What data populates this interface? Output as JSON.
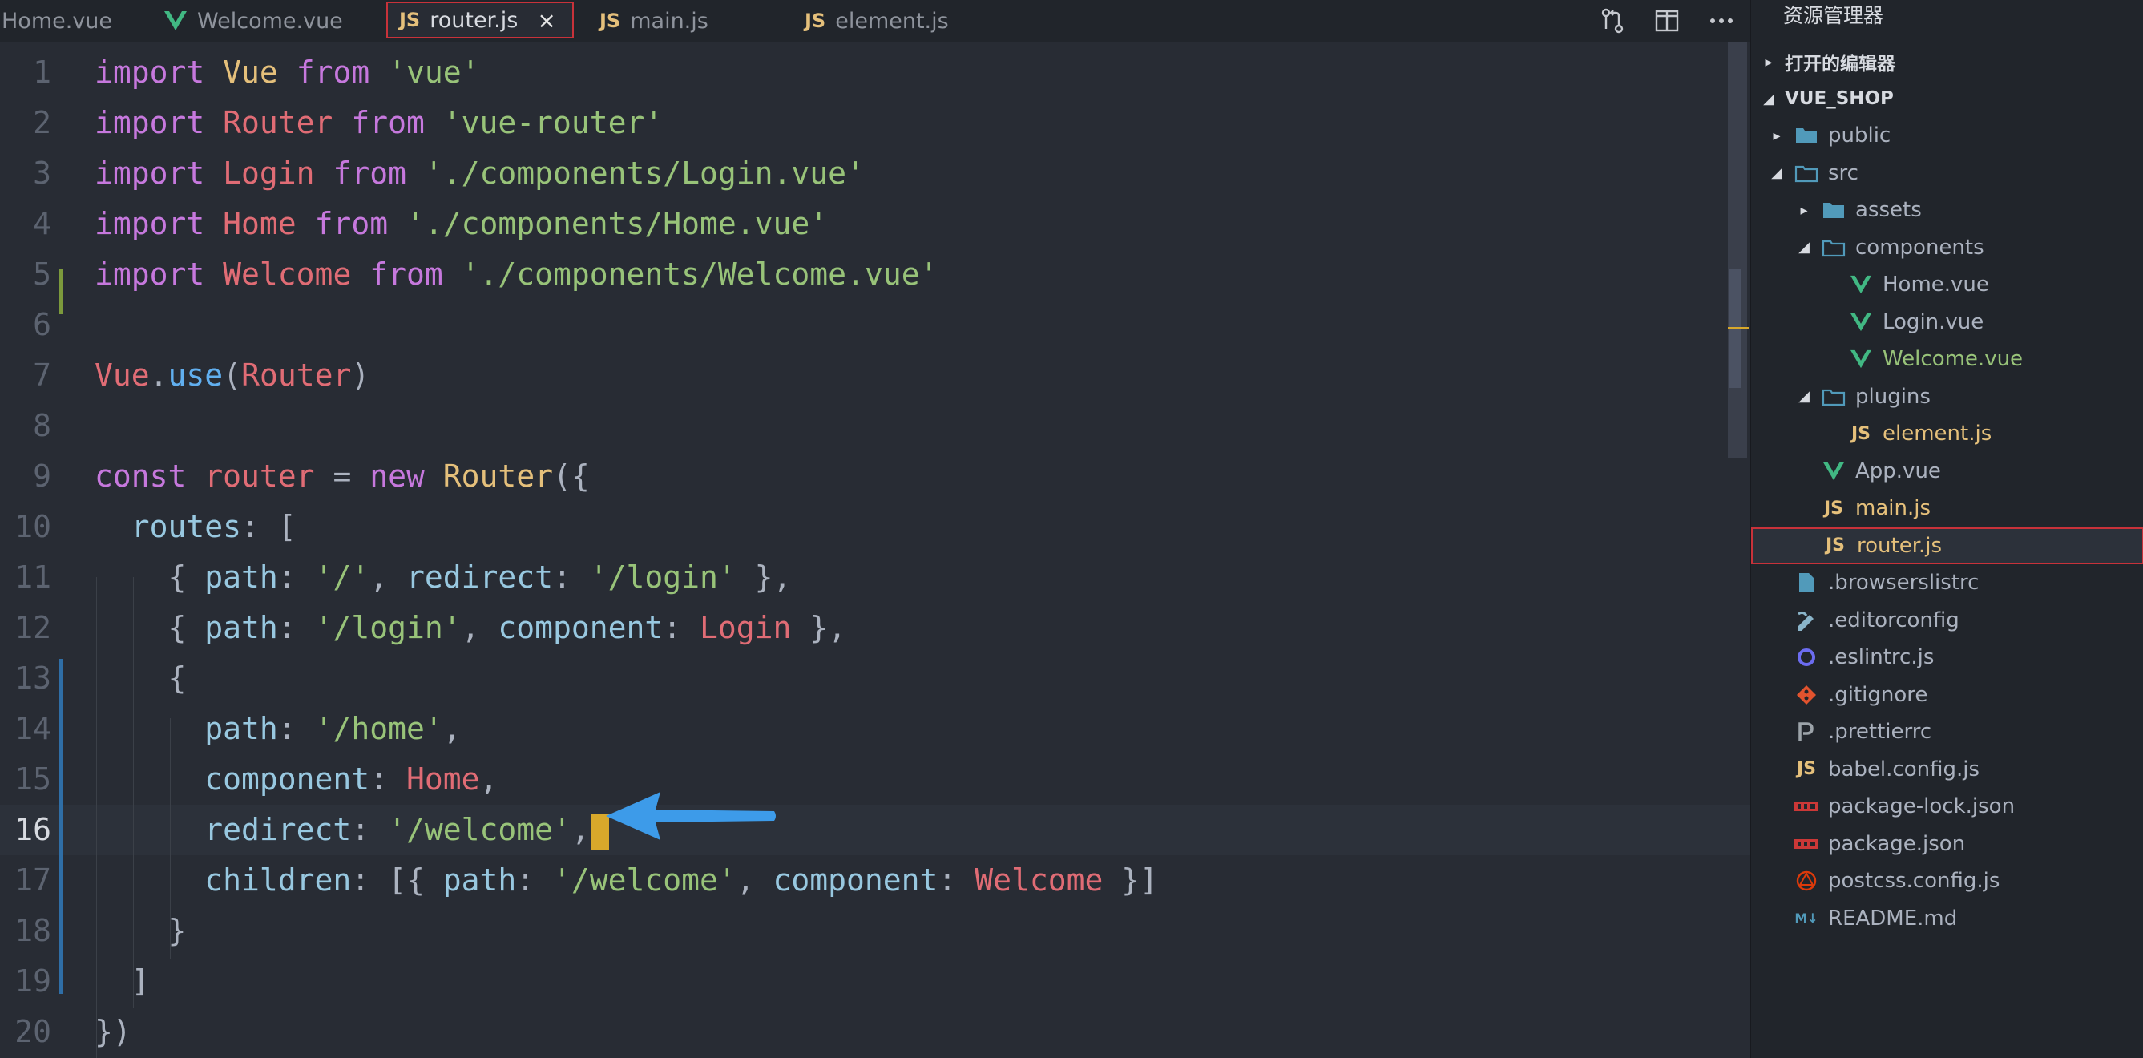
{
  "tabs": [
    {
      "label": "Home.vue",
      "type": "vue",
      "active": false
    },
    {
      "label": "Welcome.vue",
      "type": "vue",
      "active": false
    },
    {
      "label": "router.js",
      "type": "js",
      "active": true
    },
    {
      "label": "main.js",
      "type": "js",
      "active": false
    },
    {
      "label": "element.js",
      "type": "js",
      "active": false
    }
  ],
  "tab_close_glyph": "×",
  "js_badge": "JS",
  "sidebar": {
    "title": "资源管理器",
    "sections": {
      "open_editors": "打开的编辑器",
      "project": "VUE_SHOP"
    },
    "tree": [
      {
        "label": "public",
        "depth": 1,
        "kind": "folder",
        "open": false
      },
      {
        "label": "src",
        "depth": 1,
        "kind": "folder",
        "open": true
      },
      {
        "label": "assets",
        "depth": 2,
        "kind": "folder",
        "open": false
      },
      {
        "label": "components",
        "depth": 2,
        "kind": "folder",
        "open": true
      },
      {
        "label": "Home.vue",
        "depth": 3,
        "kind": "vue"
      },
      {
        "label": "Login.vue",
        "depth": 3,
        "kind": "vue"
      },
      {
        "label": "Welcome.vue",
        "depth": 3,
        "kind": "vue"
      },
      {
        "label": "plugins",
        "depth": 2,
        "kind": "folder",
        "open": true
      },
      {
        "label": "element.js",
        "depth": 3,
        "kind": "js"
      },
      {
        "label": "App.vue",
        "depth": 2,
        "kind": "vue"
      },
      {
        "label": "main.js",
        "depth": 2,
        "kind": "js"
      },
      {
        "label": "router.js",
        "depth": 2,
        "kind": "js",
        "selected": true
      },
      {
        "label": ".browserslistrc",
        "depth": 1,
        "kind": "file"
      },
      {
        "label": ".editorconfig",
        "depth": 1,
        "kind": "editorconfig"
      },
      {
        "label": ".eslintrc.js",
        "depth": 1,
        "kind": "eslint"
      },
      {
        "label": ".gitignore",
        "depth": 1,
        "kind": "git"
      },
      {
        "label": ".prettierrc",
        "depth": 1,
        "kind": "prettier"
      },
      {
        "label": "babel.config.js",
        "depth": 1,
        "kind": "js"
      },
      {
        "label": "package-lock.json",
        "depth": 1,
        "kind": "npm"
      },
      {
        "label": "package.json",
        "depth": 1,
        "kind": "npm"
      },
      {
        "label": "postcss.config.js",
        "depth": 1,
        "kind": "postcss"
      },
      {
        "label": "README.md",
        "depth": 1,
        "kind": "md"
      }
    ]
  },
  "editor": {
    "current_line": 16,
    "lines": [
      [
        [
          "kw",
          "import"
        ],
        [
          "pun",
          " "
        ],
        [
          "cls",
          "Vue"
        ],
        [
          "pun",
          " "
        ],
        [
          "kw",
          "from"
        ],
        [
          "pun",
          " "
        ],
        [
          "str",
          "'vue'"
        ]
      ],
      [
        [
          "kw",
          "import"
        ],
        [
          "pun",
          " "
        ],
        [
          "var",
          "Router"
        ],
        [
          "pun",
          " "
        ],
        [
          "kw",
          "from"
        ],
        [
          "pun",
          " "
        ],
        [
          "str",
          "'vue-router'"
        ]
      ],
      [
        [
          "kw",
          "import"
        ],
        [
          "pun",
          " "
        ],
        [
          "var",
          "Login"
        ],
        [
          "pun",
          " "
        ],
        [
          "kw",
          "from"
        ],
        [
          "pun",
          " "
        ],
        [
          "str",
          "'./components/Login.vue'"
        ]
      ],
      [
        [
          "kw",
          "import"
        ],
        [
          "pun",
          " "
        ],
        [
          "var",
          "Home"
        ],
        [
          "pun",
          " "
        ],
        [
          "kw",
          "from"
        ],
        [
          "pun",
          " "
        ],
        [
          "str",
          "'./components/Home.vue'"
        ]
      ],
      [
        [
          "kw",
          "import"
        ],
        [
          "pun",
          " "
        ],
        [
          "var",
          "Welcome"
        ],
        [
          "pun",
          " "
        ],
        [
          "kw",
          "from"
        ],
        [
          "pun",
          " "
        ],
        [
          "str",
          "'./components/Welcome.vue'"
        ]
      ],
      [],
      [
        [
          "var",
          "Vue"
        ],
        [
          "pun",
          "."
        ],
        [
          "fn",
          "use"
        ],
        [
          "pun",
          "("
        ],
        [
          "var",
          "Router"
        ],
        [
          "pun",
          ")"
        ]
      ],
      [],
      [
        [
          "kw",
          "const"
        ],
        [
          "pun",
          " "
        ],
        [
          "var",
          "router"
        ],
        [
          "pun",
          " = "
        ],
        [
          "kw",
          "new"
        ],
        [
          "pun",
          " "
        ],
        [
          "cls",
          "Router"
        ],
        [
          "pun",
          "({"
        ]
      ],
      [
        [
          "pun",
          "  "
        ],
        [
          "prop",
          "routes"
        ],
        [
          "pun",
          ": ["
        ]
      ],
      [
        [
          "pun",
          "    { "
        ],
        [
          "prop",
          "path"
        ],
        [
          "pun",
          ": "
        ],
        [
          "str",
          "'/'"
        ],
        [
          "pun",
          ", "
        ],
        [
          "prop",
          "redirect"
        ],
        [
          "pun",
          ": "
        ],
        [
          "str",
          "'/login'"
        ],
        [
          "pun",
          " },"
        ]
      ],
      [
        [
          "pun",
          "    { "
        ],
        [
          "prop",
          "path"
        ],
        [
          "pun",
          ": "
        ],
        [
          "str",
          "'/login'"
        ],
        [
          "pun",
          ", "
        ],
        [
          "prop",
          "component"
        ],
        [
          "pun",
          ": "
        ],
        [
          "var",
          "Login"
        ],
        [
          "pun",
          " },"
        ]
      ],
      [
        [
          "pun",
          "    {"
        ]
      ],
      [
        [
          "pun",
          "      "
        ],
        [
          "prop",
          "path"
        ],
        [
          "pun",
          ": "
        ],
        [
          "str",
          "'/home'"
        ],
        [
          "pun",
          ","
        ]
      ],
      [
        [
          "pun",
          "      "
        ],
        [
          "prop",
          "component"
        ],
        [
          "pun",
          ": "
        ],
        [
          "var",
          "Home"
        ],
        [
          "pun",
          ","
        ]
      ],
      [
        [
          "pun",
          "      "
        ],
        [
          "prop",
          "redirect"
        ],
        [
          "pun",
          ": "
        ],
        [
          "str",
          "'/welcome'"
        ],
        [
          "pun",
          ","
        ]
      ],
      [
        [
          "pun",
          "      "
        ],
        [
          "prop",
          "children"
        ],
        [
          "pun",
          ": [{ "
        ],
        [
          "prop",
          "path"
        ],
        [
          "pun",
          ": "
        ],
        [
          "str",
          "'/welcome'"
        ],
        [
          "pun",
          ", "
        ],
        [
          "prop",
          "component"
        ],
        [
          "pun",
          ": "
        ],
        [
          "var",
          "Welcome"
        ],
        [
          "pun",
          " }]"
        ]
      ],
      [
        [
          "pun",
          "    }"
        ]
      ],
      [
        [
          "pun",
          "  ]"
        ]
      ],
      [
        [
          "pun",
          "})"
        ]
      ]
    ]
  },
  "colors": {
    "accent_border": "#c8323a",
    "arrow": "#3d9be9",
    "caret": "#d8a82b"
  }
}
